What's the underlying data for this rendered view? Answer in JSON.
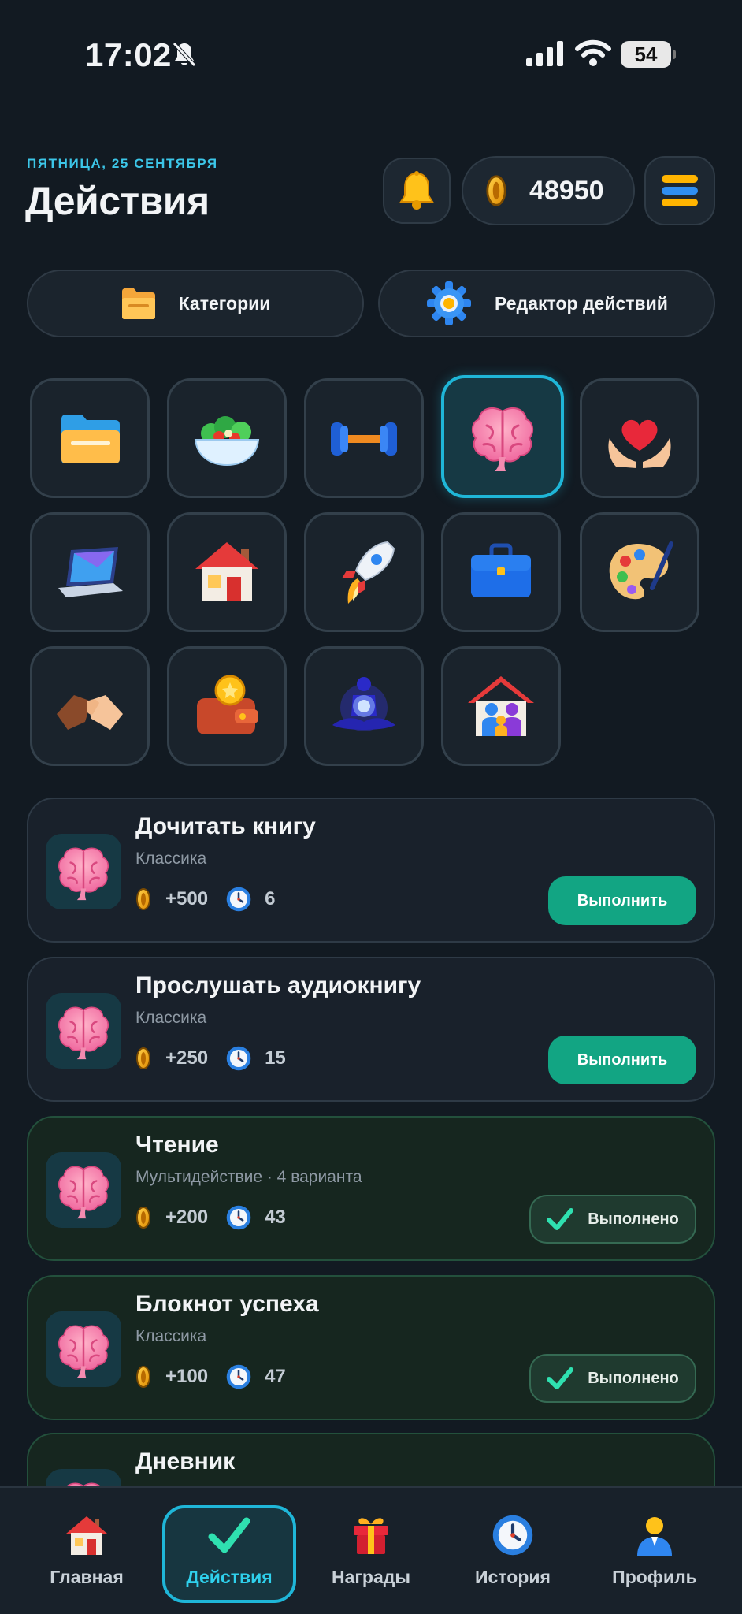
{
  "status_bar": {
    "time": "17:02",
    "battery": "54"
  },
  "header": {
    "date": "ПЯТНИЦА, 25 СЕНТЯБРЯ",
    "title": "Действия",
    "coins": "48950"
  },
  "pills": {
    "categories": "Категории",
    "editor": "Редактор действий"
  },
  "categories": [
    {
      "icon": "folder-icon"
    },
    {
      "icon": "salad-icon"
    },
    {
      "icon": "dumbbell-icon"
    },
    {
      "icon": "brain-icon",
      "active": true
    },
    {
      "icon": "heart-hands-icon"
    },
    {
      "icon": "laptop-icon"
    },
    {
      "icon": "house-icon"
    },
    {
      "icon": "rocket-icon"
    },
    {
      "icon": "briefcase-icon"
    },
    {
      "icon": "palette-icon"
    },
    {
      "icon": "handshake-icon"
    },
    {
      "icon": "wallet-icon"
    },
    {
      "icon": "meditation-icon"
    },
    {
      "icon": "family-home-icon"
    }
  ],
  "actions": [
    {
      "title": "Дочитать книгу",
      "subtitle": "Классика",
      "coins": "+500",
      "count": "6",
      "button": "Выполнить",
      "done": false
    },
    {
      "title": "Прослушать аудиокнигу",
      "subtitle": "Классика",
      "coins": "+250",
      "count": "15",
      "button": "Выполнить",
      "done": false
    },
    {
      "title": "Чтение",
      "subtitle": "Мультидействие · 4 варианта",
      "coins": "+200",
      "count": "43",
      "button": "Выполнено",
      "done": true
    },
    {
      "title": "Блокнот успеха",
      "subtitle": "Классика",
      "coins": "+100",
      "count": "47",
      "button": "Выполнено",
      "done": true
    },
    {
      "title": "Дневник",
      "subtitle": "",
      "coins": "",
      "count": "",
      "button": "",
      "done": true
    }
  ],
  "nav": [
    {
      "label": "Главная",
      "icon": "home-icon"
    },
    {
      "label": "Действия",
      "icon": "checkmark-icon",
      "active": true
    },
    {
      "label": "Награды",
      "icon": "gift-icon"
    },
    {
      "label": "История",
      "icon": "clock-icon"
    },
    {
      "label": "Профиль",
      "icon": "profile-icon"
    }
  ],
  "colors": {
    "background": "#121a22",
    "accent": "#1fb6d8",
    "primary_button": "#12a583",
    "date_text": "#3cc6e8"
  }
}
